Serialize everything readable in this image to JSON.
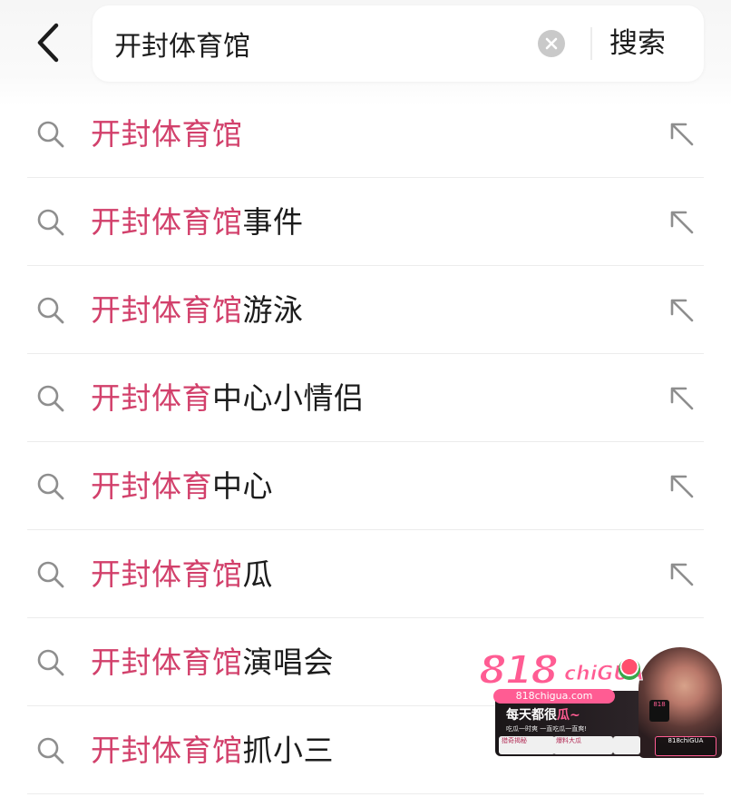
{
  "colors": {
    "highlight": "#d2406b",
    "text": "#1c1c1c",
    "icon": "#8e8e8e"
  },
  "header": {
    "back_icon": "chevron-left-icon",
    "search": {
      "value": "开封体育馆",
      "clear_icon": "clear-circle-icon"
    },
    "search_button_label": "搜索"
  },
  "suggestions": [
    {
      "highlight": "开封体育馆",
      "rest": ""
    },
    {
      "highlight": "开封体育馆",
      "rest": "事件"
    },
    {
      "highlight": "开封体育馆",
      "rest": "游泳"
    },
    {
      "highlight": "开封体育",
      "rest": "中心小情侣"
    },
    {
      "highlight": "开封体育",
      "rest": "中心"
    },
    {
      "highlight": "开封体育馆",
      "rest": "瓜"
    },
    {
      "highlight": "开封体育馆",
      "rest": "演唱会"
    },
    {
      "highlight": "开封体育馆",
      "rest": "抓小三"
    }
  ],
  "ad": {
    "logo_number": "818",
    "logo_word": "chiGUA",
    "domain": "818chigua.com",
    "slogan_prefix": "每天都很",
    "slogan_highlight": "瓜~",
    "subline": "吃瓜一时爽 一直吃瓜一直爽!",
    "chip1": "猎奇揭秘",
    "chip2": "爆料大瓜",
    "chip3": "",
    "photo_tag": "818",
    "badge": "818chiGUA"
  }
}
